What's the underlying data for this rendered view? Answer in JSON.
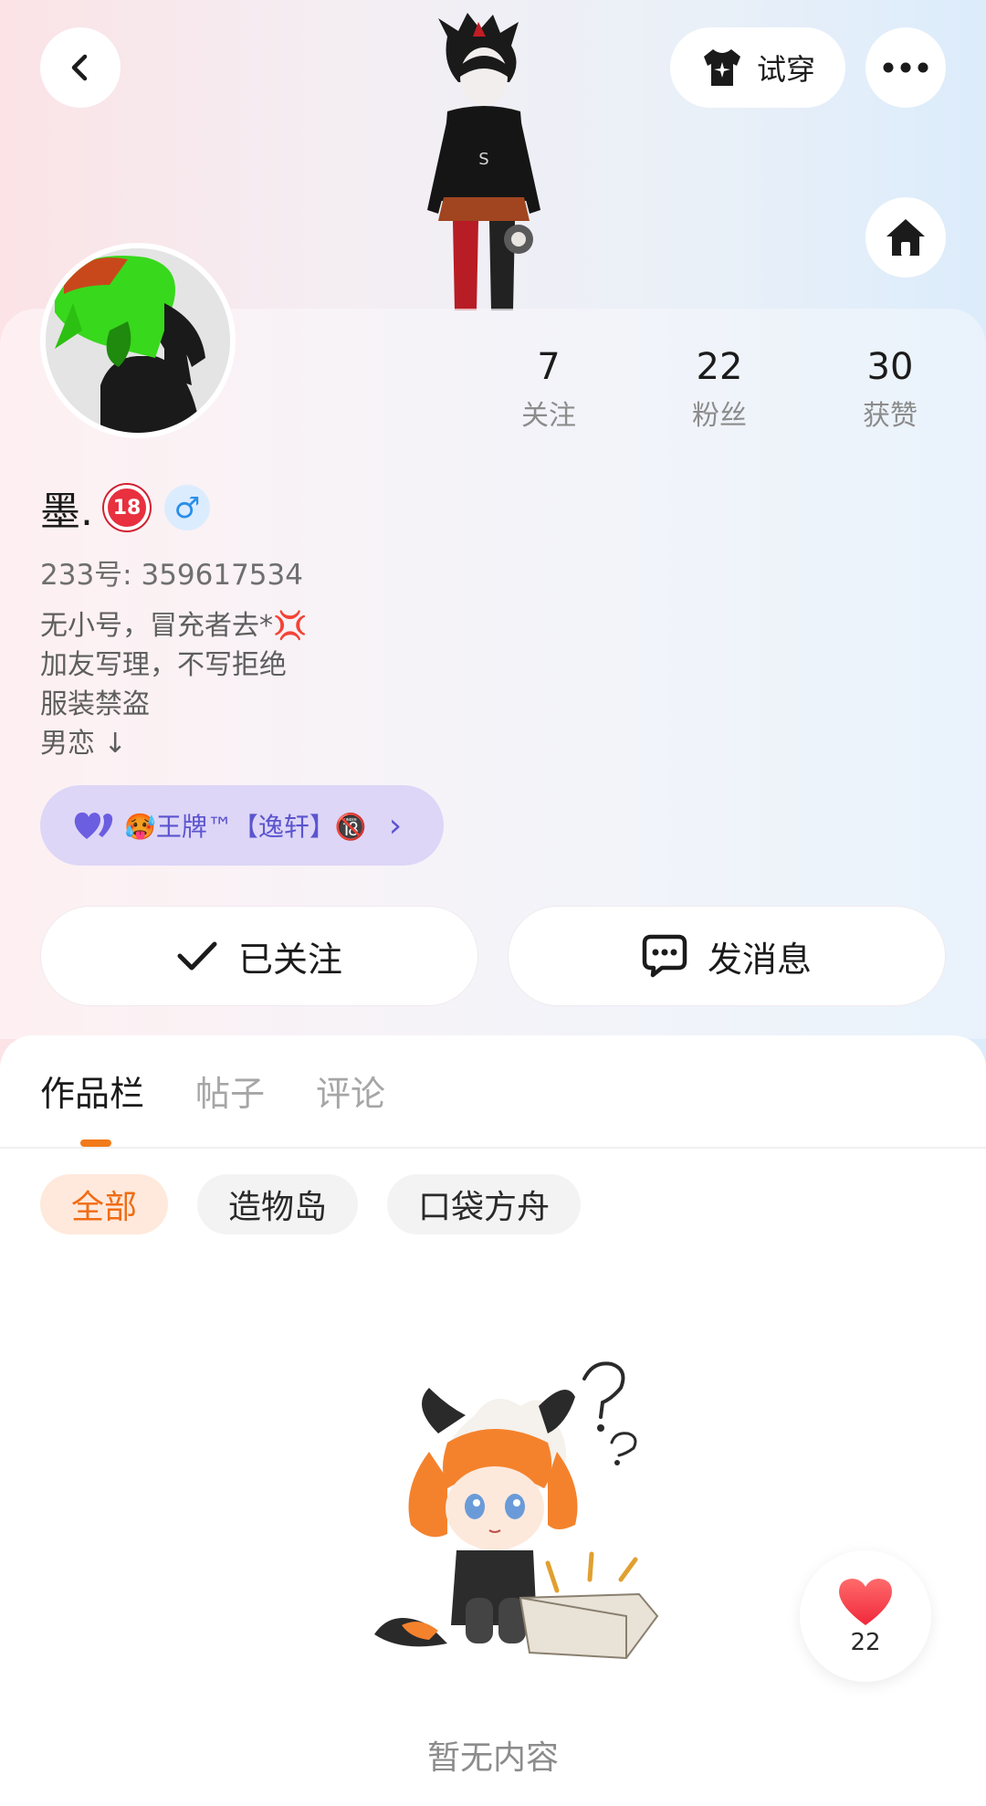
{
  "header": {
    "try_on_label": "试穿"
  },
  "stats": [
    {
      "value": "7",
      "label": "关注"
    },
    {
      "value": "22",
      "label": "粉丝"
    },
    {
      "value": "30",
      "label": "获赞"
    }
  ],
  "profile": {
    "name": "墨.",
    "age_badge": "18",
    "gender_symbol": "♂",
    "uid_text": "233号: 359617534",
    "bio_lines": [
      "无小号，冒充者去*💢",
      "加友写理，不写拒绝",
      "服装禁盗",
      "男恋 ↓"
    ]
  },
  "group_chip": {
    "label": "🥵王牌™【逸轩】🔞",
    "chevron": "›"
  },
  "actions": {
    "follow_label": "已关注",
    "message_label": "发消息"
  },
  "tabs": [
    {
      "label": "作品栏",
      "active": true
    },
    {
      "label": "帖子",
      "active": false
    },
    {
      "label": "评论",
      "active": false
    }
  ],
  "filters": [
    {
      "label": "全部",
      "active": true
    },
    {
      "label": "造物岛",
      "active": false
    },
    {
      "label": "口袋方舟",
      "active": false
    }
  ],
  "empty_state": {
    "text": "暂无内容"
  },
  "like_fab": {
    "count": "22"
  },
  "colors": {
    "accent_orange": "#f06c14",
    "heart_red": "#f0283c",
    "chip_purple": "#5b54cf"
  }
}
